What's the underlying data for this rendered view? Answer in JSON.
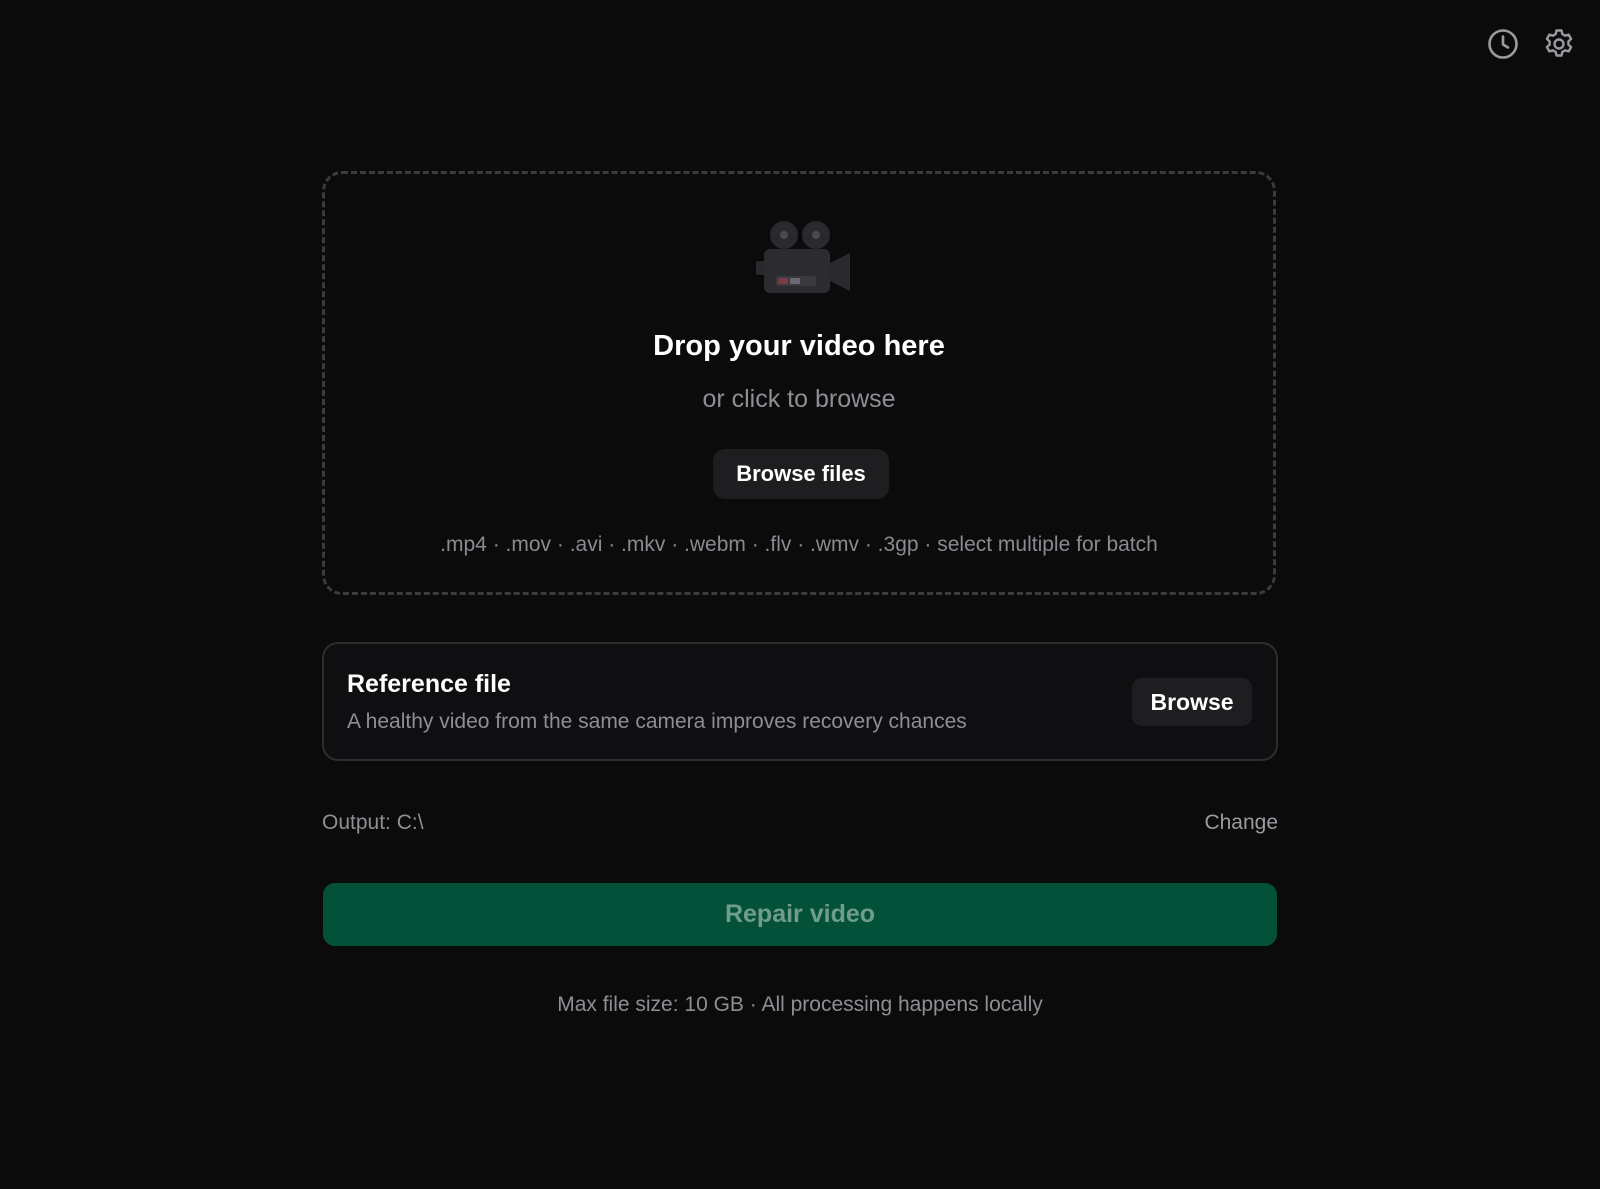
{
  "header": {
    "history_icon": "clock-icon",
    "settings_icon": "gear-icon"
  },
  "dropzone": {
    "icon": "movie-camera-icon",
    "title": "Drop your video here",
    "subtitle": "or click to browse",
    "browse_label": "Browse files",
    "formats": ".mp4 · .mov · .avi · .mkv · .webm · .flv · .wmv · .3gp · select multiple for batch"
  },
  "reference": {
    "title": "Reference file",
    "description": "A healthy video from the same camera improves recovery chances",
    "browse_label": "Browse"
  },
  "output": {
    "label": "Output: C:\\",
    "change_label": "Change"
  },
  "repair": {
    "label": "Repair video",
    "accent": "#04513a"
  },
  "footer": {
    "note": "Max file size: 10 GB · All processing happens locally"
  }
}
